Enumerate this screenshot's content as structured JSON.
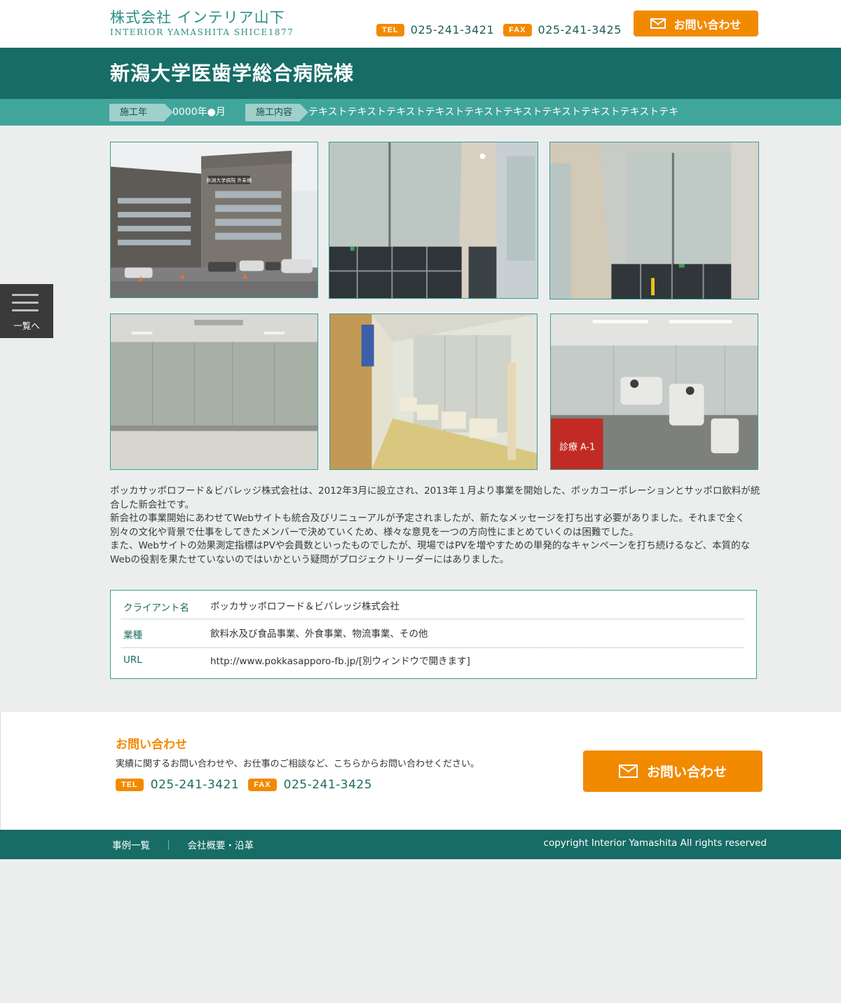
{
  "header": {
    "logo_jp": "株式会社 インテリア山下",
    "logo_en": "INTERIOR YAMASHITA SHICE1877",
    "tel_label": "TEL",
    "tel": "025-241-3421",
    "fax_label": "FAX",
    "fax": "025-241-3425",
    "contact_button": "お問い合わせ",
    "accent_color": "#f28a00"
  },
  "page": {
    "title": "新潟大学医歯学総合病院様",
    "year_label": "施工年",
    "year_value": "0000年●月",
    "work_label": "施工内容",
    "work_value": "テキストテキストテキストテキストテキストテキストテキストテキストテキストテキ"
  },
  "side_tab": {
    "icon": "menu-icon",
    "label": "一覧へ"
  },
  "gallery": [
    {
      "name": "hospital-exterior-photo",
      "sign": "新潟大学病院 外来棟"
    },
    {
      "name": "lobby-roller-blinds-photo"
    },
    {
      "name": "atrium-roller-blinds-photo"
    },
    {
      "name": "room-window-blinds-photo"
    },
    {
      "name": "corridor-blinds-photo"
    },
    {
      "name": "dental-clinic-blinds-photo",
      "sign": "診療 A-1"
    }
  ],
  "description": [
    "ポッカサッポロフード＆ビバレッジ株式会社は、2012年3月に設立され、2013年１月より事業を開始した、ポッカコーポレーションとサッポロ飲料が統合した新会社です。",
    "新会社の事業開始にあわせてWebサイトも統合及びリニューアルが予定されましたが、新たなメッセージを打ち出す必要がありました。それまで全く別々の文化や背景で仕事をしてきたメンバーで決めていくため、様々な意見を一つの方向性にまとめていくのは困難でした。",
    "また、Webサイトの効果測定指標はPVや会員数といったものでしたが、現場ではPVを増やすための単発的なキャンペーンを打ち続けるなど、本質的なWebの役割を果たせていないのではいかという疑問がプロジェクトリーダーにはありました。"
  ],
  "info_table": [
    {
      "key": "クライアント名",
      "value": "ポッカサッポロフード＆ビバレッジ株式会社"
    },
    {
      "key": "業種",
      "value": "飲料水及び食品事業、外食事業、物流事業、その他"
    },
    {
      "key": "URL",
      "value": "http://www.pokkasapporo-fb.jp/[別ウィンドウで開きます]"
    }
  ],
  "contact": {
    "title": "お問い合わせ",
    "text": "実績に関するお問い合わせや、お仕事のご相談など、こちらからお問い合わせください。",
    "tel_label": "TEL",
    "tel": "025-241-3421",
    "fax_label": "FAX",
    "fax": "025-241-3425",
    "button": "お問い合わせ"
  },
  "footer": {
    "nav": [
      "事例一覧",
      "会社概要・沿革"
    ],
    "separator": "｜",
    "copyright": "copyright Interior Yamashita All rights reserved",
    "bg_color": "#176c65"
  }
}
